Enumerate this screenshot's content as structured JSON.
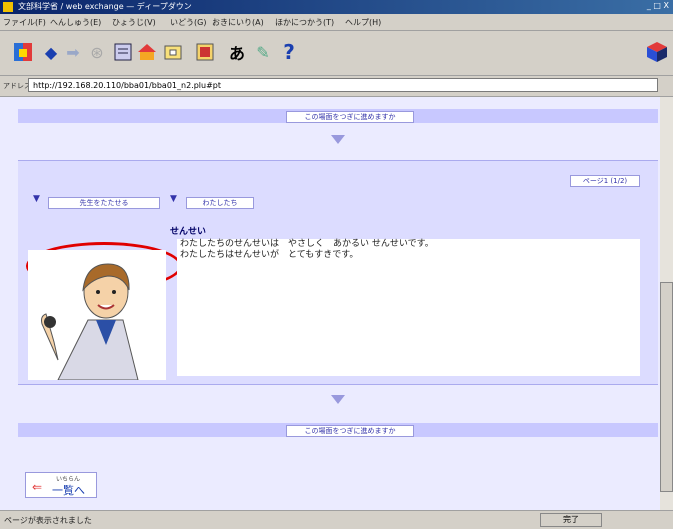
{
  "window": {
    "title": "文部科学省 / web exchange — ディープダウン",
    "controls": "_ □ X"
  },
  "menu": [
    "ファイル(F)",
    "へんしゅう(E)",
    "ひょうじ(V)",
    "いどう(G)",
    "おきにいり(A)",
    "ほかにつかう(T)",
    "ヘルプ(H)"
  ],
  "toolbar": {
    "icons": [
      "home-icon",
      "back-arrow-icon",
      "forward-arrow-icon",
      "stop-icon",
      "document-icon",
      "house-icon",
      "folder-icon",
      "image-icon",
      "font-icon",
      "print-icon",
      "help-icon",
      "logo-icon"
    ],
    "font_glyph": "あ",
    "help_glyph": "?"
  },
  "address": {
    "label": "アドレス",
    "url": "http://192.168.20.110/bba01/bba01_n2.plu#pt"
  },
  "content": {
    "top_band_button": "この場面をつぎに進めますか",
    "bottom_band_button": "この場面をつぎに進めますか",
    "page_number_button": "ページ1 (1/2)",
    "left_button": "先生をたたせる",
    "right_button": "わたしたち",
    "speaker": "せんせい",
    "lines": [
      "わたしたちのせんせいは　やさしく　あかるい せんせいです。",
      "わたしたちはせんせいが　とてもすきです。"
    ],
    "back_button_small": "いちらん",
    "back_button_main": "一覧へ"
  },
  "statusbar": {
    "text": "ページが表示されました",
    "zone": "完了"
  },
  "colors": {
    "accent": "#c8c8ff",
    "highlight": "#e00000",
    "background": "#ebebff"
  }
}
